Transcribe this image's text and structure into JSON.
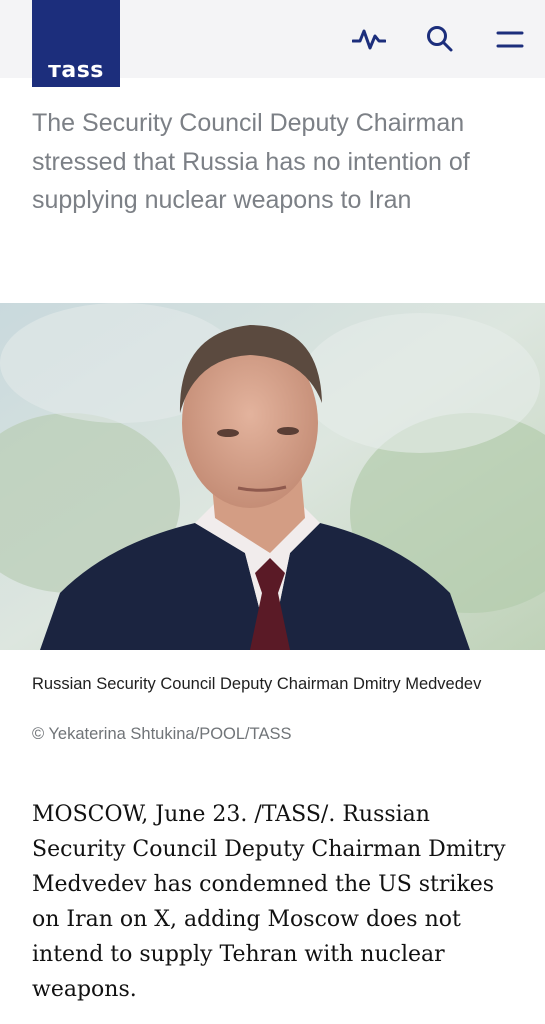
{
  "header": {
    "logo_text": "тass",
    "icons": [
      "activity-icon",
      "search-icon",
      "menu-icon"
    ],
    "brand_color": "#1c2e7c"
  },
  "article": {
    "lead": "The Security Council Deputy Chairman stressed that Russia has no intention of supplying nuclear weapons to Iran",
    "photo_caption": "Russian Security Council Deputy Chairman Dmitry Medvedev",
    "photo_credit": "© Yekaterina Shtukina/POOL/TASS",
    "body": "MOSCOW, June 23. /TASS/. Russian Security Council Deputy Chairman Dmitry Medvedev has condemned the US strikes on Iran on X, adding Moscow does not intend to supply Tehran with nuclear weapons."
  }
}
